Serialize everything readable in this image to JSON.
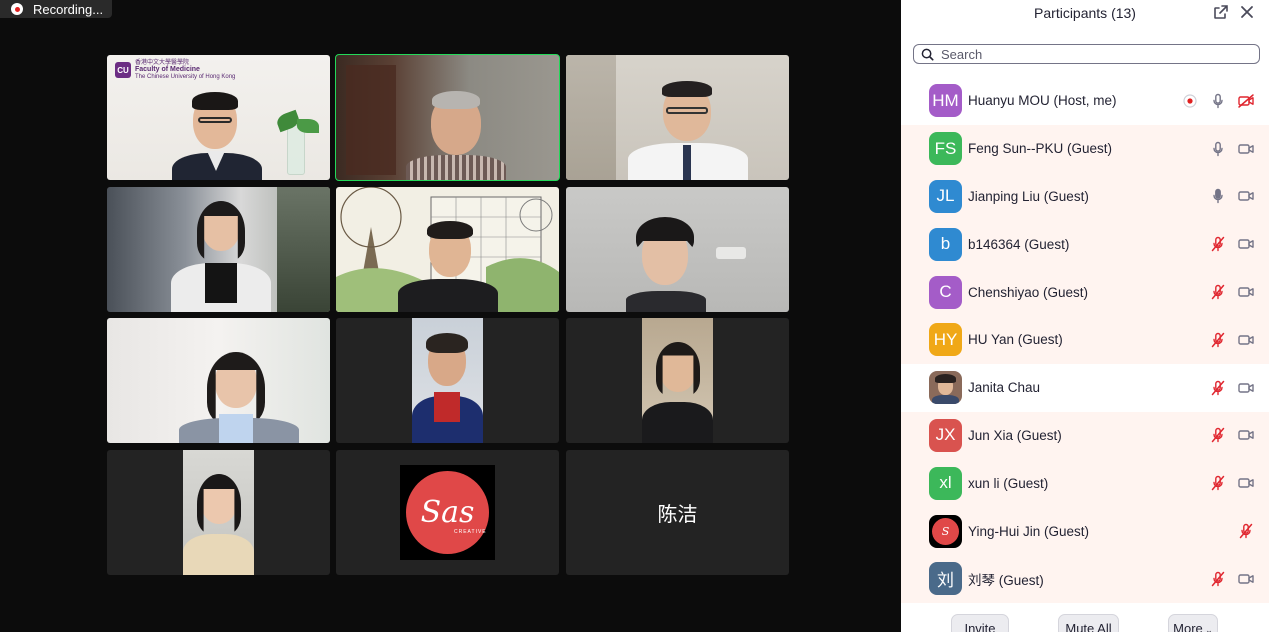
{
  "recording": {
    "label": "Recording..."
  },
  "gallery": {
    "tiles": [
      {
        "id": "t1",
        "kind": "video",
        "active": false
      },
      {
        "id": "t2",
        "kind": "video",
        "active": true
      },
      {
        "id": "t3",
        "kind": "video",
        "active": false
      },
      {
        "id": "t4",
        "kind": "video",
        "active": false
      },
      {
        "id": "t5",
        "kind": "video",
        "active": false
      },
      {
        "id": "t6",
        "kind": "video",
        "active": false
      },
      {
        "id": "t7",
        "kind": "video",
        "active": false
      },
      {
        "id": "t8",
        "kind": "video",
        "active": false
      },
      {
        "id": "t9",
        "kind": "video",
        "active": false
      },
      {
        "id": "t10",
        "kind": "video",
        "active": false
      },
      {
        "id": "t11",
        "kind": "logo",
        "active": false
      },
      {
        "id": "t12",
        "kind": "name",
        "name": "陈洁",
        "active": false
      }
    ],
    "cu_logo": {
      "badge": "CU",
      "line1": "香港中文大學醫學院",
      "line2": "Faculty of Medicine",
      "line3": "The Chinese University of Hong Kong"
    },
    "sas_logo": {
      "text": "Sas",
      "sub": "CREATIVE"
    }
  },
  "panel": {
    "title": "Participants (13)",
    "search_placeholder": "Search",
    "participants": [
      {
        "initials": "HM",
        "name": "Huanyu MOU (Host, me)",
        "color": "#a45cc8",
        "mic": "on",
        "cam": "off",
        "recording": true,
        "tinted": false
      },
      {
        "initials": "FS",
        "name": "Feng Sun--PKU (Guest)",
        "color": "#3cb85a",
        "mic": "on",
        "cam": "on",
        "recording": false,
        "tinted": true
      },
      {
        "initials": "JL",
        "name": "Jianping Liu (Guest)",
        "color": "#2f8ad1",
        "mic": "active",
        "cam": "on",
        "recording": false,
        "tinted": true
      },
      {
        "initials": "b",
        "name": "b146364 (Guest)",
        "color": "#2f8ad1",
        "mic": "muted",
        "cam": "on",
        "recording": false,
        "tinted": true
      },
      {
        "initials": "C",
        "name": "Chenshiyao (Guest)",
        "color": "#a45cc8",
        "mic": "muted",
        "cam": "on",
        "recording": false,
        "tinted": true
      },
      {
        "initials": "HY",
        "name": "HU Yan (Guest)",
        "color": "#f0a817",
        "mic": "muted",
        "cam": "on",
        "recording": false,
        "tinted": true
      },
      {
        "initials": "",
        "name": "Janita Chau",
        "color": "#8a6a5a",
        "mic": "muted",
        "cam": "on",
        "recording": false,
        "tinted": false,
        "photo": true
      },
      {
        "initials": "JX",
        "name": "Jun Xia (Guest)",
        "color": "#d9534f",
        "mic": "muted",
        "cam": "on",
        "recording": false,
        "tinted": true
      },
      {
        "initials": "xl",
        "name": "xun li (Guest)",
        "color": "#3cb85a",
        "mic": "muted",
        "cam": "on",
        "recording": false,
        "tinted": true
      },
      {
        "initials": "",
        "name": "Ying-Hui Jin (Guest)",
        "color": "#e04848",
        "mic": "muted",
        "cam": "none",
        "recording": false,
        "tinted": true,
        "logo": true
      },
      {
        "initials": "刘",
        "name": "刘琴 (Guest)",
        "color": "#4a6a8a",
        "mic": "muted",
        "cam": "on",
        "recording": false,
        "tinted": true
      }
    ],
    "footer": {
      "invite": "Invite",
      "mute_all": "Mute All",
      "more": "More"
    }
  },
  "colors": {
    "accent_active": "#23d959",
    "record_red": "#e02020",
    "muted_red": "#e0262f",
    "icon_gray": "#747487"
  }
}
